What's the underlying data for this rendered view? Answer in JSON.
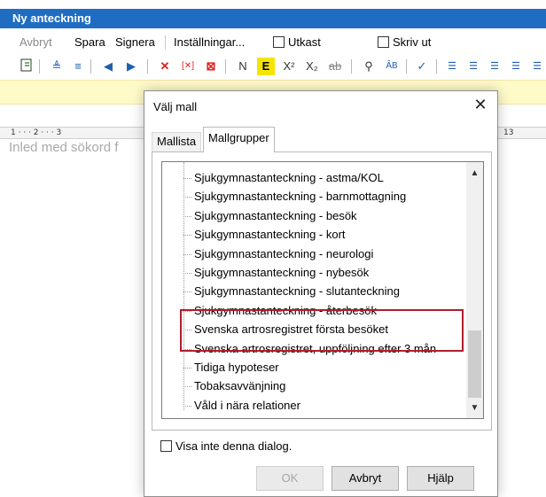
{
  "window": {
    "title": "Ny anteckning"
  },
  "menu": {
    "items": [
      "Avbryt",
      "Spara",
      "Signera",
      "Inställningar..."
    ],
    "checkboxes": [
      "Utkast",
      "Skriv ut"
    ]
  },
  "toolbar": {
    "format_letters": {
      "normal": "N",
      "emphasis": "E",
      "superscript": "X²",
      "subscript": "X₂",
      "strikethrough": "ab"
    }
  },
  "ruler": {
    "left_text": "1 · · · 2 · · · 3",
    "right_text": "13"
  },
  "editor": {
    "placeholder": "Inled med sökord f"
  },
  "dialog": {
    "title": "Välj mall",
    "tabs": [
      "Mallista",
      "Mallgrupper"
    ],
    "active_tab": "Mallgrupper",
    "templates": [
      "Sjukgymnastanteckning - astma/KOL",
      "Sjukgymnastanteckning - barnmottagning",
      "Sjukgymnastanteckning - besök",
      "Sjukgymnastanteckning - kort",
      "Sjukgymnastanteckning - neurologi",
      "Sjukgymnastanteckning - nybesök",
      "Sjukgymnastanteckning - slutanteckning",
      "Sjukgymnastanteckning - återbesök",
      "Svenska artrosregistret första besöket",
      "Svenska artrosregistret, uppföljning efter 3 mån",
      "Tidiga hypoteser",
      "Tobaksavvänjning",
      "Våld i nära relationer"
    ],
    "highlighted_items": [
      "Svenska artrosregistret första besöket",
      "Svenska artrosregistret, uppföljning efter 3 mån"
    ],
    "highlight_color": "#b01e2c",
    "dont_show_label": "Visa inte denna dialog.",
    "buttons": {
      "ok": "OK",
      "cancel": "Avbryt",
      "help": "Hjälp"
    },
    "ok_enabled": false
  },
  "colors": {
    "titlebar": "#1f6dc2",
    "editor_strip": "#fffbc9",
    "emphasis_bg": "#f5e400"
  }
}
